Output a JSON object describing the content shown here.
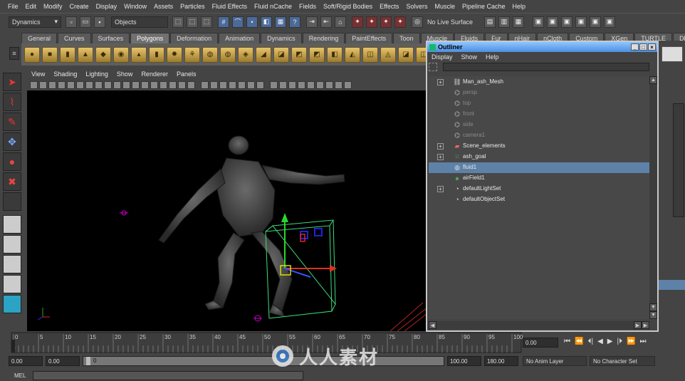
{
  "menubar": {
    "items": [
      "File",
      "Edit",
      "Modify",
      "Create",
      "Display",
      "Window",
      "Assets",
      "Particles",
      "Fluid Effects",
      "Fluid nCache",
      "Fields",
      "Soft/Rigid Bodies",
      "Effects",
      "Solvers",
      "Muscle",
      "Pipeline Cache",
      "Help"
    ]
  },
  "statusline": {
    "menuset": "Dynamics",
    "selection_mode": "Objects",
    "live_surface": "No Live Surface"
  },
  "shelf": {
    "tabs": [
      "General",
      "Curves",
      "Surfaces",
      "Polygons",
      "Deformation",
      "Animation",
      "Dynamics",
      "Rendering",
      "PaintEffects",
      "Toon",
      "Muscle",
      "Fluids",
      "Fur",
      "nHair",
      "nCloth",
      "Custom",
      "XGen",
      "TURTLE",
      "DMM"
    ],
    "active_tab": "Polygons"
  },
  "viewport": {
    "menu": [
      "View",
      "Shading",
      "Lighting",
      "Show",
      "Renderer",
      "Panels"
    ]
  },
  "outliner": {
    "title": "Outliner",
    "menu": [
      "Display",
      "Show",
      "Help"
    ],
    "items": [
      {
        "label": "Man_ash_Mesh",
        "icon": "mesh-icon",
        "expandable": true,
        "dim": false,
        "selected": false
      },
      {
        "label": "persp",
        "icon": "camera-icon",
        "expandable": false,
        "dim": true,
        "selected": false
      },
      {
        "label": "top",
        "icon": "camera-icon",
        "expandable": false,
        "dim": true,
        "selected": false
      },
      {
        "label": "front",
        "icon": "camera-icon",
        "expandable": false,
        "dim": true,
        "selected": false
      },
      {
        "label": "side",
        "icon": "camera-icon",
        "expandable": false,
        "dim": true,
        "selected": false
      },
      {
        "label": "camera1",
        "icon": "camera-icon",
        "expandable": false,
        "dim": true,
        "selected": false
      },
      {
        "label": "Scene_elements",
        "icon": "group-icon",
        "expandable": true,
        "dim": false,
        "selected": false
      },
      {
        "label": "ash_goal",
        "icon": "particle-icon",
        "expandable": true,
        "dim": false,
        "selected": false
      },
      {
        "label": "fluid1",
        "icon": "fluid-icon",
        "expandable": false,
        "dim": false,
        "selected": true
      },
      {
        "label": "airField1",
        "icon": "field-icon",
        "expandable": false,
        "dim": false,
        "selected": false
      },
      {
        "label": "defaultLightSet",
        "icon": "set-icon",
        "expandable": true,
        "dim": false,
        "selected": false
      },
      {
        "label": "defaultObjectSet",
        "icon": "set-icon",
        "expandable": false,
        "dim": false,
        "selected": false
      }
    ]
  },
  "timeline": {
    "ticks": [
      "0",
      "5",
      "10",
      "15",
      "20",
      "25",
      "30",
      "35",
      "40",
      "45",
      "50",
      "55",
      "60",
      "65",
      "70",
      "75",
      "80",
      "85",
      "90",
      "95",
      "100"
    ],
    "current_time": "0.00",
    "current_frame": "0"
  },
  "rangebar": {
    "start_time": "0.00",
    "playback_start": "0.00",
    "range_value": "0",
    "playback_end": "100.00",
    "end_time": "180.00",
    "anim_layer": "No Anim Layer",
    "character_set": "No Character Set"
  },
  "cmdline": {
    "label": "MEL"
  },
  "watermark": {
    "text": "人人素材"
  }
}
